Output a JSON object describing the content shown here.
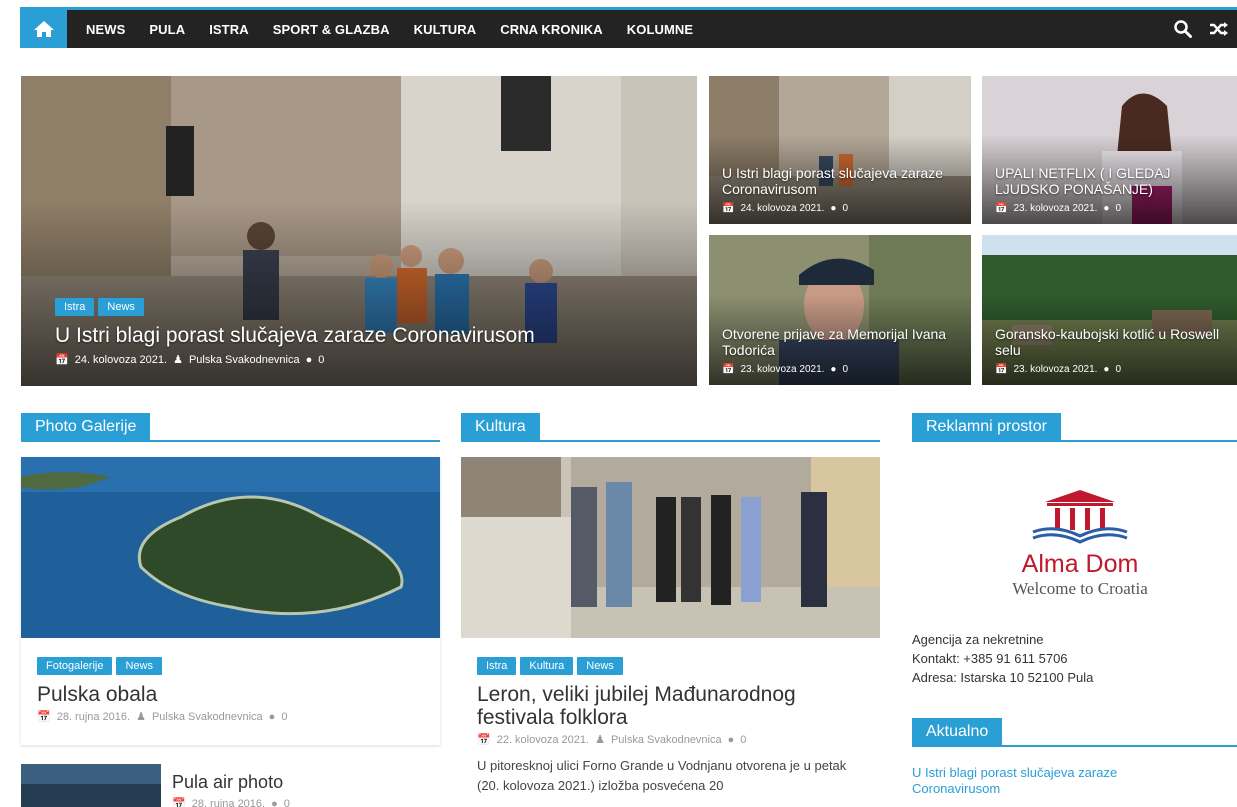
{
  "nav": {
    "items": [
      "NEWS",
      "PULA",
      "ISTRA",
      "SPORT & GLAZBA",
      "KULTURA",
      "CRNA KRONIKA",
      "KOLUMNE"
    ],
    "accent": "#2a9fd6"
  },
  "featured": {
    "main": {
      "tags": [
        "Istra",
        "News"
      ],
      "title": "U Istri blagi porast slučajeva zaraze Coronavirusom",
      "date": "24. kolovoza 2021.",
      "author": "Pulska Svakodnevnica",
      "comments": "0"
    },
    "items": [
      {
        "title": "U Istri blagi porast slučajeva zaraze Coronavirusom",
        "date": "24. kolovoza 2021.",
        "comments": "0"
      },
      {
        "title": "UPALI NETFLIX ( I GLEDAJ LJUDSKO PONAŠANJE)",
        "date": "23. kolovoza 2021.",
        "comments": "0"
      },
      {
        "title": "Otvorene prijave za Memorijal Ivana Todorića",
        "date": "23. kolovoza 2021.",
        "comments": "0"
      },
      {
        "title": "Goransko-kaubojski kotlić u Roswell selu",
        "date": "23. kolovoza 2021.",
        "comments": "0"
      }
    ]
  },
  "sections": {
    "photo": {
      "heading": "Photo Galerije",
      "article": {
        "tags": [
          "Fotogalerije",
          "News"
        ],
        "title": "Pulska obala",
        "date": "28. rujna 2016.",
        "author": "Pulska Svakodnevnica",
        "comments": "0"
      },
      "small": {
        "title": "Pula air photo",
        "date": "28. rujna 2016.",
        "comments": "0"
      }
    },
    "kultura": {
      "heading": "Kultura",
      "article": {
        "tags": [
          "Istra",
          "Kultura",
          "News"
        ],
        "title": "Leron, veliki jubilej Mađunarodnog festivala folklora",
        "date": "22. kolovoza 2021.",
        "author": "Pulska Svakodnevnica",
        "comments": "0",
        "excerpt": "U pitoresknoj ulici Forno Grande u Vodnjanu otvorena je u petak (20. kolovoza 2021.) izložba posvećena 20"
      }
    },
    "reklame": {
      "heading": "Reklamni prostor",
      "logo_name": "Alma Dom",
      "logo_tagline": "Welcome to Croatia",
      "lines": [
        "Agencija za nekretnine",
        "Kontakt: +385 91 611 5706",
        "Adresa: Istarska 10 52100 Pula"
      ]
    },
    "aktualno": {
      "heading": "Aktualno",
      "link": "U Istri blagi porast slučajeva zaraze Coronavirusom"
    }
  }
}
